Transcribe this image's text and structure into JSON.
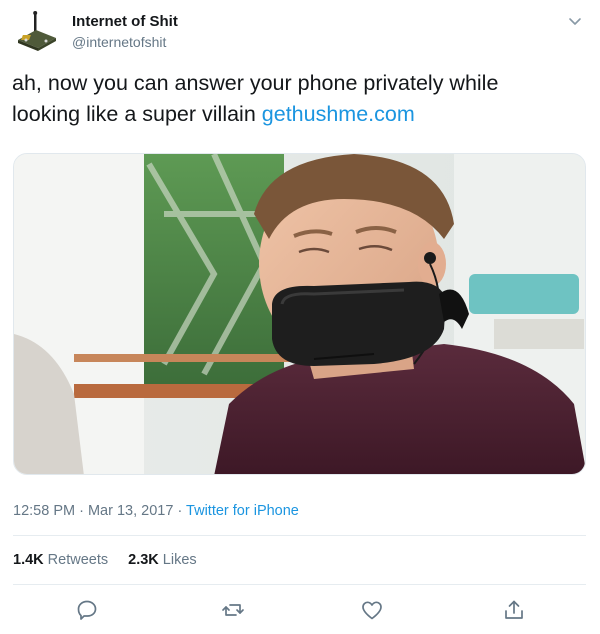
{
  "header": {
    "display_name": "Internet of Shit",
    "handle": "@internetofshit",
    "avatar_icon": "iot-device-avatar-icon",
    "menu_icon": "chevron-down-icon"
  },
  "tweet": {
    "text": "ah, now you can answer your phone privately while looking like a super villain ",
    "link_text": "gethushme.com",
    "media_description_icon": "photo"
  },
  "meta": {
    "time": "12:58 PM",
    "separator": " · ",
    "date": "Mar 13, 2017",
    "separator2": " · ",
    "source": "Twitter for iPhone"
  },
  "stats": {
    "retweets_count": "1.4K",
    "retweets_label": " Retweets",
    "likes_count": "2.3K",
    "likes_label": " Likes"
  },
  "actions": {
    "reply_icon": "reply-icon",
    "retweet_icon": "retweet-icon",
    "like_icon": "heart-icon",
    "share_icon": "share-icon"
  },
  "colors": {
    "link": "#1b95e0",
    "secondary_text": "#657786",
    "primary_text": "#14171a"
  }
}
